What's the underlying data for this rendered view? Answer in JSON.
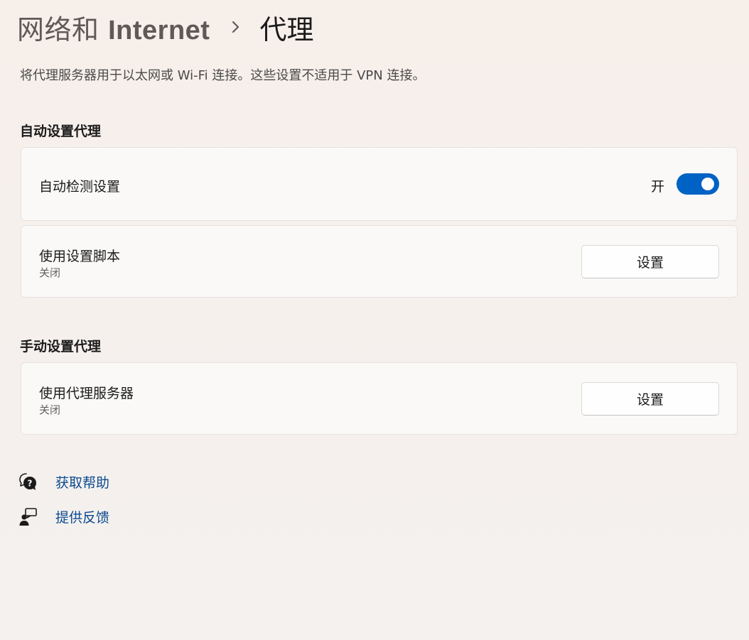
{
  "breadcrumb": {
    "parent_cjk": "网络和",
    "parent_latin": "Internet",
    "current": "代理"
  },
  "description": "将代理服务器用于以太网或 Wi-Fi 连接。这些设置不适用于 VPN 连接。",
  "auto_section": {
    "title": "自动设置代理",
    "detect": {
      "label": "自动检测设置",
      "toggle_state": "开",
      "enabled": true
    },
    "script": {
      "label": "使用设置脚本",
      "status": "关闭",
      "button": "设置"
    }
  },
  "manual_section": {
    "title": "手动设置代理",
    "proxy": {
      "label": "使用代理服务器",
      "status": "关闭",
      "button": "设置"
    }
  },
  "links": {
    "help": {
      "label": "获取帮助",
      "icon": "help-chat-icon"
    },
    "feedback": {
      "label": "提供反馈",
      "icon": "feedback-person-icon"
    }
  },
  "colors": {
    "accent": "#0062c4",
    "link": "#0a4a8f"
  }
}
